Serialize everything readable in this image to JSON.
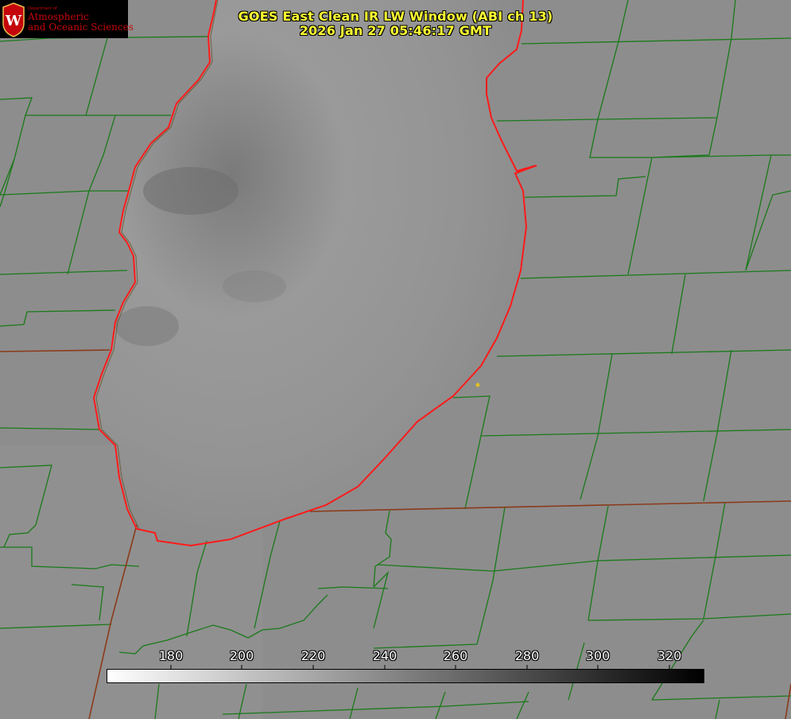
{
  "title": {
    "line1": "GOES East Clean IR LW Window (ABI ch 13)",
    "line2": "2026 Jan 27 05:46:17 GMT"
  },
  "logo": {
    "department": "Department of",
    "line1": "Atmospheric",
    "line2": "and Oceanic Sciences",
    "crest_letter": "W"
  },
  "colorbar": {
    "ticks": [
      "180",
      "200",
      "220",
      "240",
      "260",
      "280",
      "300",
      "320"
    ],
    "gradient_start": "#ffffff",
    "gradient_end": "#000000"
  },
  "colors": {
    "lake_outline": "#ff1a1a",
    "county_lines": "#1a7a1a",
    "state_lines": "#8b3a1a",
    "title_text": "#ffff33",
    "marker": "#e0c020"
  }
}
